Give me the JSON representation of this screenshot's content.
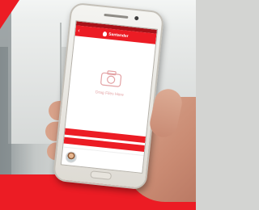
{
  "app": {
    "brand_name": "Santander",
    "upload_prompt": "Drag Files Here",
    "sub_text": "",
    "action_1": "",
    "action_2": "",
    "contact_name": "",
    "contact_role": ""
  },
  "colors": {
    "brand_red": "#ec1c24"
  },
  "icons": {
    "upload": "camera-icon",
    "back": "back-arrow-icon"
  }
}
